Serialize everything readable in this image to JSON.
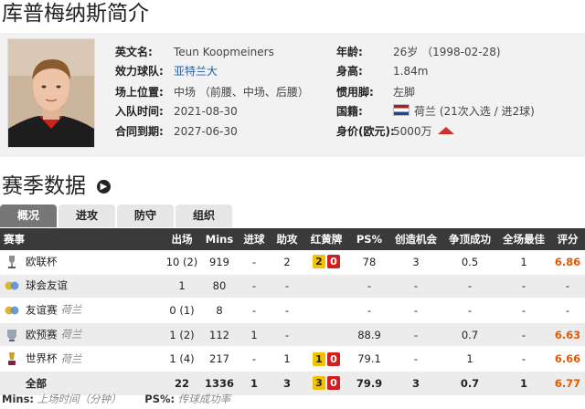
{
  "page_title": "库普梅纳斯简介",
  "profile": {
    "left": [
      {
        "label": "英文名:",
        "value": "Teun Koopmeiners"
      },
      {
        "label": "效力球队:",
        "value": "亚特兰大"
      },
      {
        "label": "场上位置:",
        "value": "中场 （前腰、中场、后腰）"
      },
      {
        "label": "入队时间:",
        "value": "2021-08-30"
      },
      {
        "label": "合同到期:",
        "value": "2027-06-30"
      }
    ],
    "right": [
      {
        "label": "年龄:",
        "value": "26岁 （1998-02-28)"
      },
      {
        "label": "身高:",
        "value": "1.84m"
      },
      {
        "label": "惯用脚:",
        "value": "左脚"
      },
      {
        "label": "国籍:",
        "value": "荷兰 (21次入选 / 进2球)"
      },
      {
        "label": "身价(欧元):",
        "value": "5000万"
      }
    ],
    "team_color": "#1e5fb3",
    "market_trend_icon": "up-triangle-icon",
    "nationality_flag": "netherlands-flag-icon"
  },
  "stats_section": {
    "title": "赛季数据",
    "tabs": [
      "概况",
      "进攻",
      "防守",
      "组织"
    ],
    "active_tab": 0,
    "headers": [
      "赛事",
      "出场",
      "Mins",
      "进球",
      "助攻",
      "红黄牌",
      "PS%",
      "创造机会",
      "争顶成功",
      "全场最佳",
      "评分"
    ],
    "rows": [
      {
        "competition": "欧联杯",
        "sub": "",
        "icon": "europa-league-icon",
        "apps": "10 (2)",
        "mins": "919",
        "goals": "-",
        "assists": "2",
        "yellow": "2",
        "red": "0",
        "ps": "78",
        "chances": "3",
        "aerials": "0.5",
        "motm": "1",
        "rating": "6.86"
      },
      {
        "competition": "球会友谊",
        "sub": "",
        "icon": "club-friendly-icon",
        "apps": "1",
        "mins": "80",
        "goals": "-",
        "assists": "-",
        "yellow": "",
        "red": "",
        "ps": "-",
        "chances": "-",
        "aerials": "-",
        "motm": "-",
        "rating": "-"
      },
      {
        "competition": "友谊赛",
        "sub": "荷兰",
        "icon": "friendly-icon",
        "apps": "0 (1)",
        "mins": "8",
        "goals": "-",
        "assists": "-",
        "yellow": "",
        "red": "",
        "ps": "-",
        "chances": "-",
        "aerials": "-",
        "motm": "-",
        "rating": "-"
      },
      {
        "competition": "欧预赛",
        "sub": "荷兰",
        "icon": "euro-qualifiers-icon",
        "apps": "1 (2)",
        "mins": "112",
        "goals": "1",
        "assists": "-",
        "yellow": "",
        "red": "",
        "ps": "88.9",
        "chances": "-",
        "aerials": "0.7",
        "motm": "-",
        "rating": "6.63"
      },
      {
        "competition": "世界杯",
        "sub": "荷兰",
        "icon": "world-cup-icon",
        "apps": "1 (4)",
        "mins": "217",
        "goals": "-",
        "assists": "1",
        "yellow": "1",
        "red": "0",
        "ps": "79.1",
        "chances": "-",
        "aerials": "1",
        "motm": "-",
        "rating": "6.66"
      }
    ],
    "total": {
      "competition": "全部",
      "apps": "22",
      "mins": "1336",
      "goals": "1",
      "assists": "3",
      "yellow": "3",
      "red": "0",
      "ps": "79.9",
      "chances": "3",
      "aerials": "0.7",
      "motm": "1",
      "rating": "6.77"
    }
  },
  "footnote": {
    "k1": "Mins:",
    "d1": "上场时间（分钟）",
    "k2": "PS%:",
    "d2": "传球成功率"
  }
}
